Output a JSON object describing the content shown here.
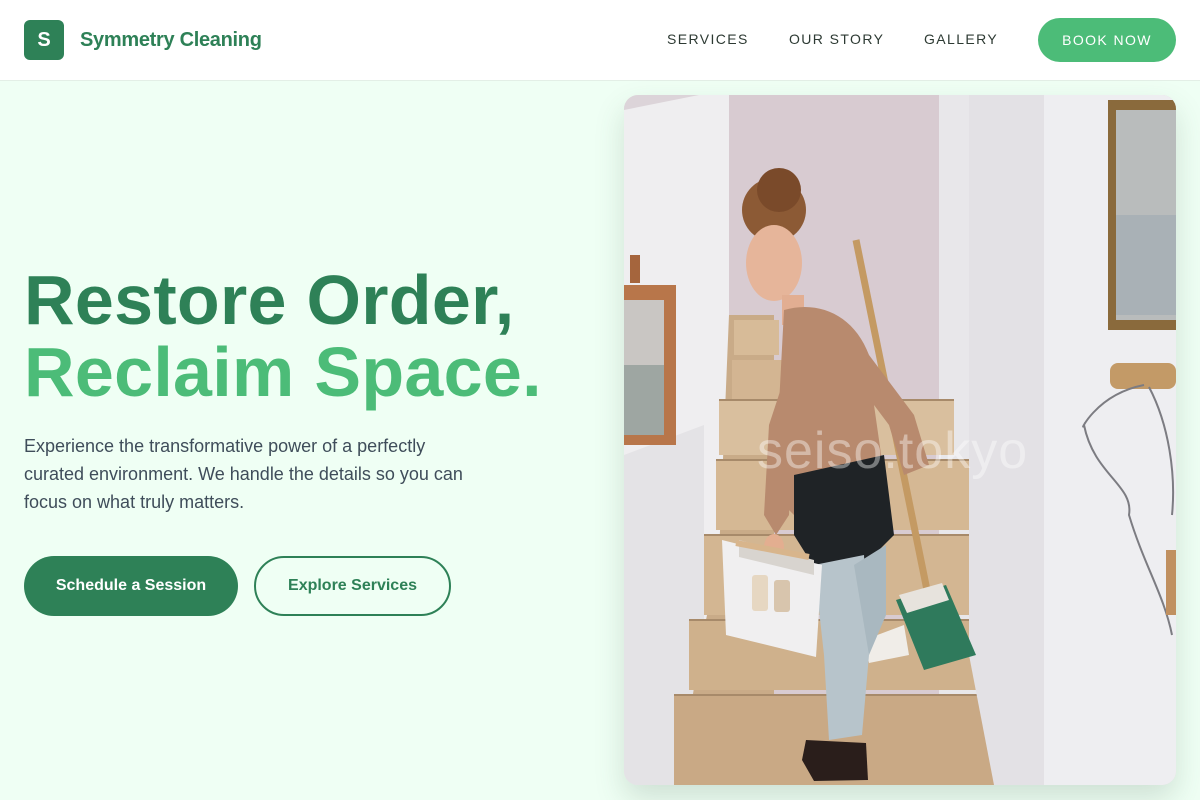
{
  "header": {
    "logo_letter": "S",
    "brand_name": "Symmetry Cleaning",
    "nav": {
      "services": "SERVICES",
      "our_story": "OUR STORY",
      "gallery": "GALLERY"
    },
    "cta": "BOOK NOW"
  },
  "hero": {
    "headline_line1": "Restore Order,",
    "headline_line2": "Reclaim Space.",
    "description": "Experience the transformative power of a perfectly curated environment. We handle the details so you can focus on what truly matters.",
    "primary_button": "Schedule a Session",
    "secondary_button": "Explore Services",
    "image": {
      "watermark": "seiso.tokyo"
    }
  },
  "colors": {
    "brand_dark_green": "#2e8157",
    "brand_light_green": "#4cbc78",
    "page_background": "#effff4",
    "body_text": "#3f4d5a"
  }
}
